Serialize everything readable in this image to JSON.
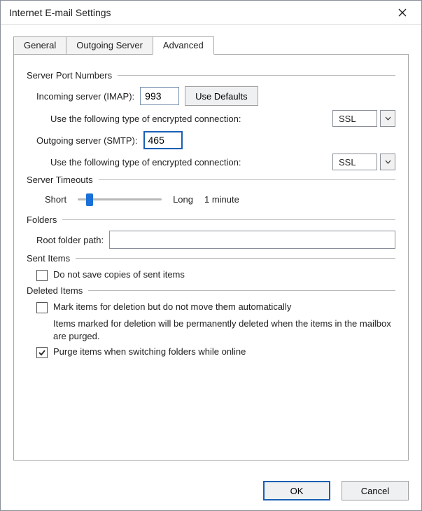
{
  "window": {
    "title": "Internet E-mail Settings"
  },
  "tabs": {
    "general": "General",
    "outgoing": "Outgoing Server",
    "advanced": "Advanced"
  },
  "groups": {
    "port": "Server Port Numbers",
    "timeouts": "Server Timeouts",
    "folders": "Folders",
    "sent": "Sent Items",
    "deleted": "Deleted Items"
  },
  "port": {
    "incoming_label": "Incoming server (IMAP):",
    "incoming_value": "993",
    "use_defaults": "Use Defaults",
    "encryption_label": "Use the following type of encrypted connection:",
    "incoming_encryption": "SSL",
    "outgoing_label": "Outgoing server (SMTP):",
    "outgoing_value": "465",
    "outgoing_encryption": "SSL"
  },
  "timeouts": {
    "short": "Short",
    "long": "Long",
    "value": "1 minute"
  },
  "folders": {
    "root_label": "Root folder path:",
    "root_value": ""
  },
  "sent": {
    "no_save_label": "Do not save copies of sent items"
  },
  "deleted": {
    "mark_label": "Mark items for deletion but do not move them automatically",
    "info": "Items marked for deletion will be permanently deleted when the items in the mailbox are purged.",
    "purge_label": "Purge items when switching folders while online"
  },
  "buttons": {
    "ok": "OK",
    "cancel": "Cancel"
  }
}
